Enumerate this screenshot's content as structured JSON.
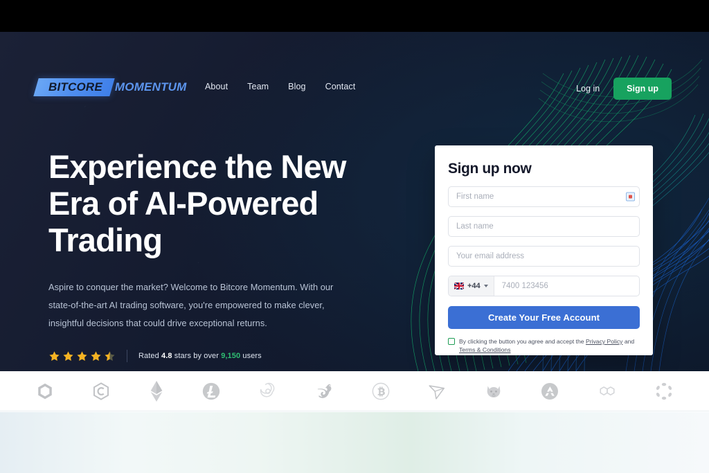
{
  "brand": {
    "logo_plate_text": "BITCORE",
    "logo_word": "MOMENTUM",
    "plate_color": "#4f8ef0",
    "word_color": "#5c95ee"
  },
  "nav": {
    "links": [
      {
        "label": "About"
      },
      {
        "label": "Team"
      },
      {
        "label": "Blog"
      },
      {
        "label": "Contact"
      }
    ],
    "login_label": "Log in",
    "signup_label": "Sign up",
    "signup_color": "#17a25f"
  },
  "hero": {
    "headline_line1": "Experience the New",
    "headline_line2": "Era of AI-Powered",
    "headline_line3": "Trading",
    "paragraph": "Aspire to conquer the market? Welcome to Bitcore Momentum. With our state-of-the-art AI trading software, you're empowered to make clever, insightful decisions that could drive exceptional returns.",
    "rating": {
      "stars_filled": 4,
      "stars_half": 1,
      "stars_total": 5,
      "star_color": "#f5b323",
      "prefix": "Rated ",
      "score": "4.8",
      "middle": " stars by over ",
      "users": "9,150",
      "suffix": " users"
    }
  },
  "signup_card": {
    "title": "Sign up now",
    "first_name": {
      "placeholder": "First name",
      "value": ""
    },
    "last_name": {
      "placeholder": "Last name",
      "value": ""
    },
    "email": {
      "placeholder": "Your email address",
      "value": ""
    },
    "phone": {
      "country_flag": "gb-flag",
      "country_code": "+44",
      "placeholder": "7400 123456",
      "value": ""
    },
    "cta_label": "Create Your Free Account",
    "cta_color": "#3b6fd4",
    "terms": {
      "checked": false,
      "checkbox_color": "#1f9d55",
      "text_before": "By clicking the button you agree and accept the ",
      "link1": "Privacy Policy",
      "text_middle": " and ",
      "link2": "Terms & Conditions"
    },
    "autofill_icon": "autofill-icon"
  },
  "crypto_strip": {
    "coins": [
      {
        "name": "chainlink-icon",
        "symbol": "LINK"
      },
      {
        "name": "chiliz-icon",
        "symbol": "CHZ"
      },
      {
        "name": "ethereum-icon",
        "symbol": "ETH"
      },
      {
        "name": "litecoin-icon",
        "symbol": "LTC"
      },
      {
        "name": "render-icon",
        "symbol": "RNDR"
      },
      {
        "name": "uniswap-icon",
        "symbol": "UNI"
      },
      {
        "name": "bitcoin-icon",
        "symbol": "BTC"
      },
      {
        "name": "tron-icon",
        "symbol": "TRX"
      },
      {
        "name": "shiba-inu-icon",
        "symbol": "SHIB"
      },
      {
        "name": "avalanche-icon",
        "symbol": "AVAX"
      },
      {
        "name": "polygon-icon",
        "symbol": "MATIC"
      },
      {
        "name": "polkadot-icon",
        "symbol": "DOT"
      }
    ]
  }
}
